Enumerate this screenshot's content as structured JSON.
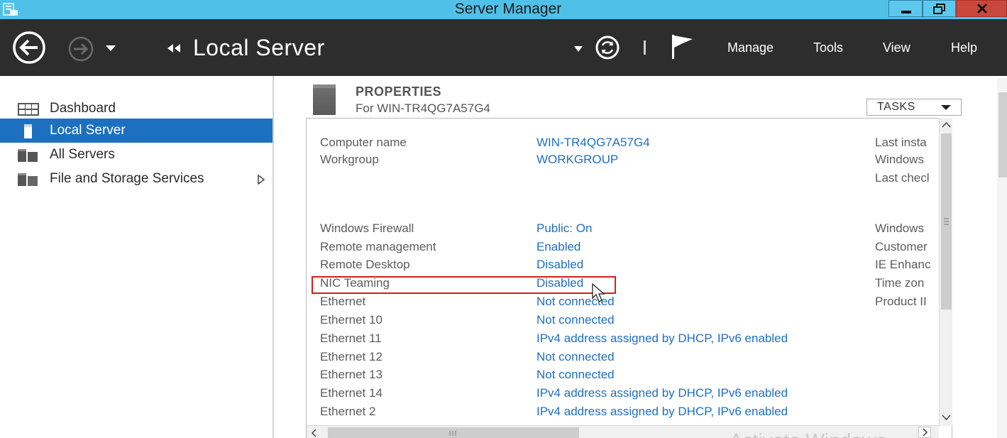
{
  "window": {
    "title": "Server Manager"
  },
  "header": {
    "breadcrumb_title": "Local Server",
    "menu": {
      "manage": "Manage",
      "tools": "Tools",
      "view": "View",
      "help": "Help"
    }
  },
  "sidebar": {
    "items": [
      {
        "label": "Dashboard",
        "icon": "dashboard-icon"
      },
      {
        "label": "Local Server",
        "icon": "server-icon",
        "active": true
      },
      {
        "label": "All Servers",
        "icon": "servers-icon"
      },
      {
        "label": "File and Storage Services",
        "icon": "storage-icon",
        "expandable": true
      }
    ]
  },
  "properties": {
    "title": "PROPERTIES",
    "subtitle": "For WIN-TR4QG7A57G4",
    "tasks_label": "TASKS",
    "rows": [
      {
        "label": "Computer name",
        "value": "WIN-TR4QG7A57G4"
      },
      {
        "label": "Workgroup",
        "value": "WORKGROUP"
      },
      {
        "label": "Windows Firewall",
        "value": "Public: On"
      },
      {
        "label": "Remote management",
        "value": "Enabled"
      },
      {
        "label": "Remote Desktop",
        "value": "Disabled"
      },
      {
        "label": "NIC Teaming",
        "value": "Disabled"
      },
      {
        "label": "Ethernet",
        "value": "Not connected"
      },
      {
        "label": "Ethernet 10",
        "value": "Not connected"
      },
      {
        "label": "Ethernet 11",
        "value": "IPv4 address assigned by DHCP, IPv6 enabled"
      },
      {
        "label": "Ethernet 12",
        "value": "Not connected"
      },
      {
        "label": "Ethernet 13",
        "value": "Not connected"
      },
      {
        "label": "Ethernet 14",
        "value": "IPv4 address assigned by DHCP, IPv6 enabled"
      },
      {
        "label": "Ethernet 2",
        "value": "IPv4 address assigned by DHCP, IPv6 enabled"
      }
    ],
    "right_column": [
      "Last insta",
      "Windows",
      "Last checl",
      "Windows",
      "Customer",
      "IE Enhanc",
      "Time zon",
      "Product II"
    ]
  },
  "watermark": "Activate Windows",
  "colors": {
    "titlebar": "#4fc0e8",
    "header": "#2d2d2d",
    "active_item": "#1d70c0",
    "link": "#1f6fc0",
    "highlight": "#d21f1f"
  }
}
